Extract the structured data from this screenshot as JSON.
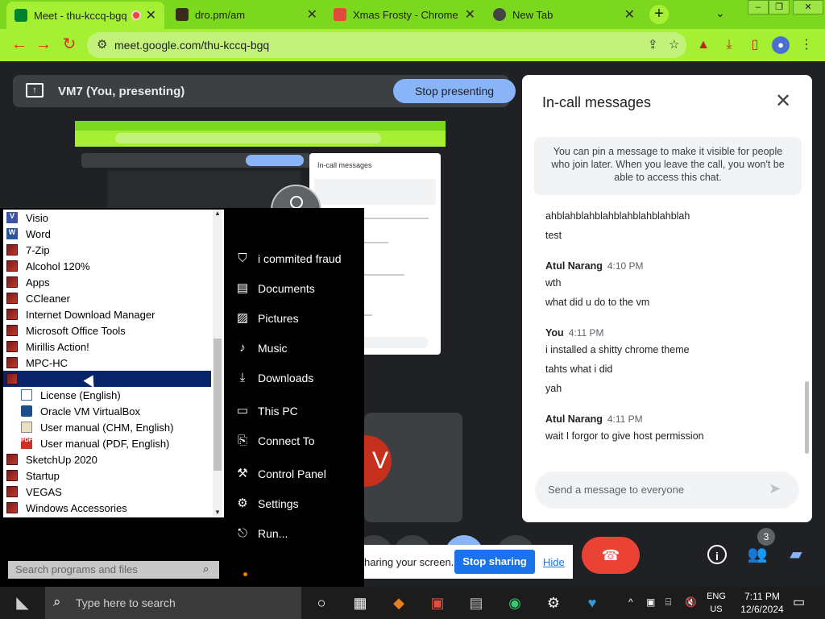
{
  "browser": {
    "tabs": [
      {
        "title": "Meet - thu-kccq-bgq",
        "active": true,
        "recording": true
      },
      {
        "title": "dro.pm/am",
        "active": false
      },
      {
        "title": "Xmas Frosty - Chrome W",
        "active": false
      },
      {
        "title": "New Tab",
        "active": false
      }
    ],
    "url": "meet.google.com/thu-kccq-bgq",
    "new_tab_icon": "plus-icon",
    "accent_color": "#7cd81f"
  },
  "meet": {
    "presenting_label": "VM7 (You, presenting)",
    "stop_presenting": "Stop presenting",
    "sharing_text": "haring your screen.",
    "stop_sharing": "Stop sharing",
    "hide": "Hide",
    "participants_count": "3",
    "hangup_color": "#ea4335"
  },
  "chat_panel": {
    "title": "In-call messages",
    "pin_note": "You can pin a message to make it visible for people who join later. When you leave the call, you won't be able to access this chat.",
    "messages": [
      {
        "sender": "",
        "time": "",
        "lines": [
          "ahblahblahblahblahblahblahblah",
          "test"
        ]
      },
      {
        "sender": "Atul Narang",
        "time": "4:10 PM",
        "lines": [
          "wth",
          "what did u do to the vm"
        ]
      },
      {
        "sender": "You",
        "time": "4:11 PM",
        "lines": [
          "i installed a shitty chrome theme",
          "tahts what i did",
          "yah"
        ]
      },
      {
        "sender": "Atul Narang",
        "time": "4:11 PM",
        "lines": [
          "wait I forgor to give host permission"
        ]
      }
    ],
    "input_placeholder": "Send a message to everyone"
  },
  "start_menu": {
    "programs": [
      {
        "label": "Visio",
        "icon": "visio"
      },
      {
        "label": "Word",
        "icon": "word"
      },
      {
        "label": "7-Zip",
        "icon": "folder"
      },
      {
        "label": "Alcohol 120%",
        "icon": "folder"
      },
      {
        "label": "Apps",
        "icon": "folder"
      },
      {
        "label": "CCleaner",
        "icon": "folder"
      },
      {
        "label": "Internet Download Manager",
        "icon": "folder"
      },
      {
        "label": "Microsoft Office Tools",
        "icon": "folder"
      },
      {
        "label": "Mirillis Action!",
        "icon": "folder"
      },
      {
        "label": "MPC-HC",
        "icon": "folder"
      },
      {
        "label": "Oracle VM VirtualBox",
        "icon": "folder",
        "selected": true
      },
      {
        "label": "License (English)",
        "icon": "doc",
        "sub": true
      },
      {
        "label": "Oracle VM VirtualBox",
        "icon": "vbox",
        "sub": true
      },
      {
        "label": "User manual (CHM, English)",
        "icon": "chm",
        "sub": true
      },
      {
        "label": "User manual (PDF, English)",
        "icon": "pdf",
        "sub": true
      },
      {
        "label": "SketchUp 2020",
        "icon": "folder"
      },
      {
        "label": "Startup",
        "icon": "folder"
      },
      {
        "label": "VEGAS",
        "icon": "folder"
      },
      {
        "label": "Windows Accessories",
        "icon": "folder"
      }
    ],
    "right_links": [
      {
        "label": "i commited fraud",
        "icon": "user-icon"
      },
      {
        "label": "Documents",
        "icon": "documents-icon"
      },
      {
        "label": "Pictures",
        "icon": "pictures-icon"
      },
      {
        "label": "Music",
        "icon": "music-icon"
      },
      {
        "label": "Downloads",
        "icon": "downloads-icon"
      },
      {
        "label": "This PC",
        "icon": "computer-icon"
      },
      {
        "label": "Connect To",
        "icon": "connect-icon"
      },
      {
        "label": "Control Panel",
        "icon": "control-panel-icon"
      },
      {
        "label": "Settings",
        "icon": "settings-icon"
      },
      {
        "label": "Run...",
        "icon": "run-icon"
      }
    ],
    "search_placeholder": "Search programs and files"
  },
  "taskbar": {
    "search_placeholder": "Type here to search",
    "lang_top": "ENG",
    "lang_bottom": "US",
    "time": "7:11 PM",
    "date": "12/6/2024"
  }
}
